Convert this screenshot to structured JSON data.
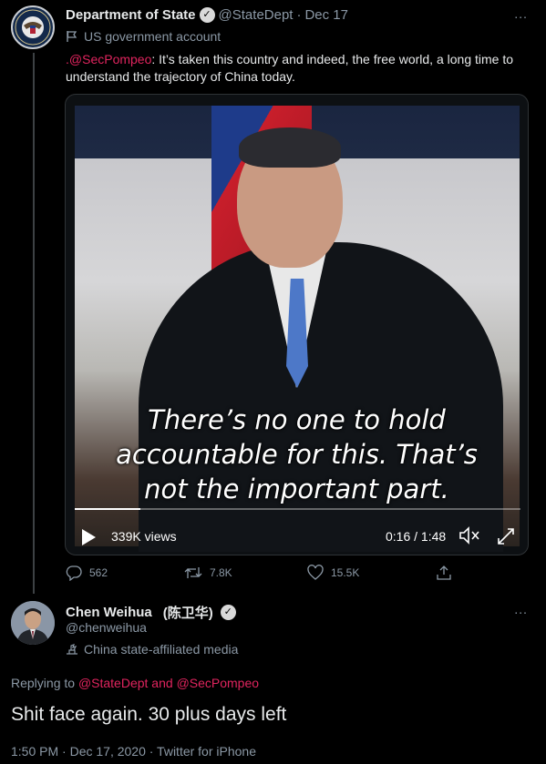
{
  "tweet": {
    "author_name": "Department of State",
    "author_handle": "@StateDept",
    "date": "Dec 17",
    "label": "US government account",
    "text_mention": ".@SecPompeo",
    "text_body": ": It’s taken this country and indeed, the free world, a long time to understand the trajectory of China today.",
    "more": "∙∙∙",
    "video": {
      "caption_lines": [
        "There’s no one to hold",
        "accountable for this.  That’s",
        "not the important part."
      ],
      "views": "339K views",
      "time": "0:16 / 1:48",
      "progress": 0.148
    },
    "actions": {
      "replies": "562",
      "retweets": "7.8K",
      "likes": "15.5K"
    }
  },
  "reply": {
    "author_name": "Chen Weihua",
    "author_name_cn": "(陈卫华)",
    "author_handle": "@chenweihua",
    "label": "China state-affiliated media",
    "more": "∙∙∙",
    "replying_prefix": "Replying to ",
    "replying_user1": "@StateDept",
    "replying_and": " and ",
    "replying_user2": "@SecPompeo",
    "text": "Shit face again.  30 plus days left",
    "meta": "1:50 PM · Dec 17, 2020 · Twitter for iPhone"
  },
  "colors": {
    "mention": "#e0245e",
    "muted": "#8b98a5",
    "text": "#e7e9ea"
  }
}
